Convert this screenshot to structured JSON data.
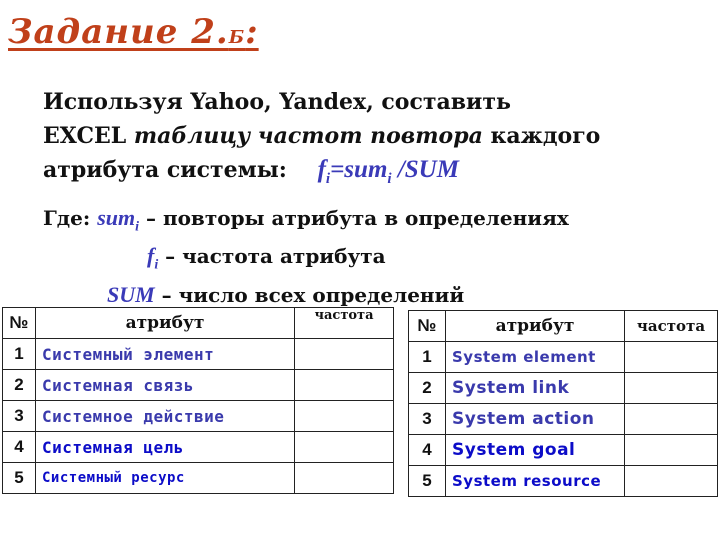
{
  "title": {
    "main": "Задание 2.",
    "sub": "Б",
    "colon": ":"
  },
  "paragraph": {
    "line1": "Используя Yahoo, Yandex, составить",
    "line2_a": "EXCEL ",
    "line2_b": "таблицу частот повтора",
    "line2_c": " каждого",
    "line3": "атрибута системы:",
    "formula": {
      "f": "f",
      "i1": "i",
      "eq": "=sum",
      "i2": "i",
      "rest": " /SUM"
    }
  },
  "where": {
    "label": "Где: ",
    "items": [
      {
        "var": "sum",
        "sub": "i",
        "text": " – повторы атрибута в определениях"
      },
      {
        "var": "f",
        "sub": "i",
        "text": " – частота атрибута"
      },
      {
        "var": "SUM",
        "sub": "",
        "text": " – число всех определений"
      }
    ]
  },
  "table_ru": {
    "headers": [
      "№",
      "атрибут",
      "частота"
    ],
    "rows": [
      {
        "n": "1",
        "attr": "Системный элемент",
        "freq": ""
      },
      {
        "n": "2",
        "attr": "Системная связь",
        "freq": ""
      },
      {
        "n": "3",
        "attr": "Системное действие",
        "freq": ""
      },
      {
        "n": "4",
        "attr": "Системная цель",
        "freq": ""
      },
      {
        "n": "5",
        "attr": "Системный ресурс",
        "freq": ""
      }
    ]
  },
  "table_en": {
    "headers": [
      "№",
      "атрибут",
      "частота"
    ],
    "rows": [
      {
        "n": "1",
        "attr": "System element",
        "freq": ""
      },
      {
        "n": "2",
        "attr": "System link",
        "freq": ""
      },
      {
        "n": "3",
        "attr": "System action",
        "freq": ""
      },
      {
        "n": "4",
        "attr": "System goal",
        "freq": ""
      },
      {
        "n": "5",
        "attr": "System resource",
        "freq": ""
      }
    ]
  },
  "colors": {
    "title": "#c0401a",
    "formula": "#3a3ab8",
    "attr_a": "#3a3aac",
    "attr_b": "#0c0cc8"
  }
}
